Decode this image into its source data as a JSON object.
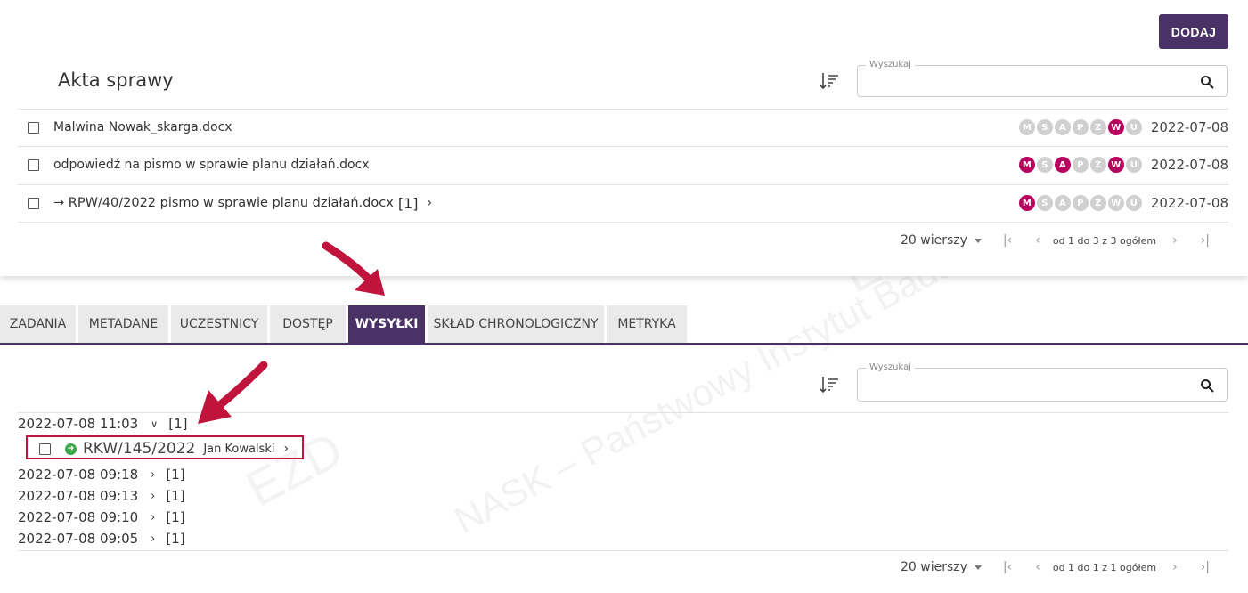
{
  "header": {
    "add_label": "DODAJ",
    "title": "Akta sprawy"
  },
  "search": {
    "label": "Wyszukaj",
    "placeholder": ""
  },
  "files": [
    {
      "name": "Malwina Nowak_skarga.docx",
      "date": "2022-07-08",
      "badges": [
        {
          "l": "M",
          "on": false
        },
        {
          "l": "S",
          "on": false
        },
        {
          "l": "A",
          "on": false
        },
        {
          "l": "P",
          "on": false
        },
        {
          "l": "Z",
          "on": false
        },
        {
          "l": "W",
          "on": true
        },
        {
          "l": "U",
          "on": false
        }
      ]
    },
    {
      "name": "odpowiedź na pismo w sprawie planu działań.docx",
      "date": "2022-07-08",
      "badges": [
        {
          "l": "M",
          "on": true
        },
        {
          "l": "S",
          "on": false
        },
        {
          "l": "A",
          "on": true
        },
        {
          "l": "P",
          "on": false
        },
        {
          "l": "Z",
          "on": false
        },
        {
          "l": "W",
          "on": true
        },
        {
          "l": "U",
          "on": false
        }
      ]
    },
    {
      "name": "→ RPW/40/2022 pismo w sprawie planu działań.docx",
      "count": "[1]",
      "date": "2022-07-08",
      "badges": [
        {
          "l": "M",
          "on": true
        },
        {
          "l": "S",
          "on": false
        },
        {
          "l": "A",
          "on": false
        },
        {
          "l": "P",
          "on": false
        },
        {
          "l": "Z",
          "on": false
        },
        {
          "l": "W",
          "on": false
        },
        {
          "l": "U",
          "on": false
        }
      ]
    }
  ],
  "pager_top": {
    "rows": "20 wierszy",
    "range": "od 1 do 3 z 3 ogółem"
  },
  "tabs": [
    "ZADANIA",
    "METADANE",
    "UCZESTNICY",
    "DOSTĘP",
    "WYSYŁKI",
    "SKŁAD CHRONOLOGICZNY",
    "METRYKA"
  ],
  "active_tab": "WYSYŁKI",
  "search2": {
    "label": "Wyszukaj"
  },
  "groups": [
    {
      "datetime": "2022-07-08 11:03",
      "count": "[1]",
      "expanded": true
    },
    {
      "datetime": "2022-07-08 09:18",
      "count": "[1]",
      "expanded": false
    },
    {
      "datetime": "2022-07-08 09:13",
      "count": "[1]",
      "expanded": false
    },
    {
      "datetime": "2022-07-08 09:10",
      "count": "[1]",
      "expanded": false
    },
    {
      "datetime": "2022-07-08 09:05",
      "count": "[1]",
      "expanded": false
    }
  ],
  "shipment": {
    "number": "RKW/145/2022",
    "person": "Jan Kowalski"
  },
  "pager_bottom": {
    "rows": "20 wierszy",
    "range": "od 1 do 1 z 1 ogółem"
  },
  "colors": {
    "primary": "#4a3266",
    "badge_on": "#b8005f",
    "highlight": "#c0143c",
    "arrow": "#c0143c"
  },
  "watermark": {
    "text1": "EZD",
    "text2": "NASK – Państwowy Instytut Badawczy"
  }
}
